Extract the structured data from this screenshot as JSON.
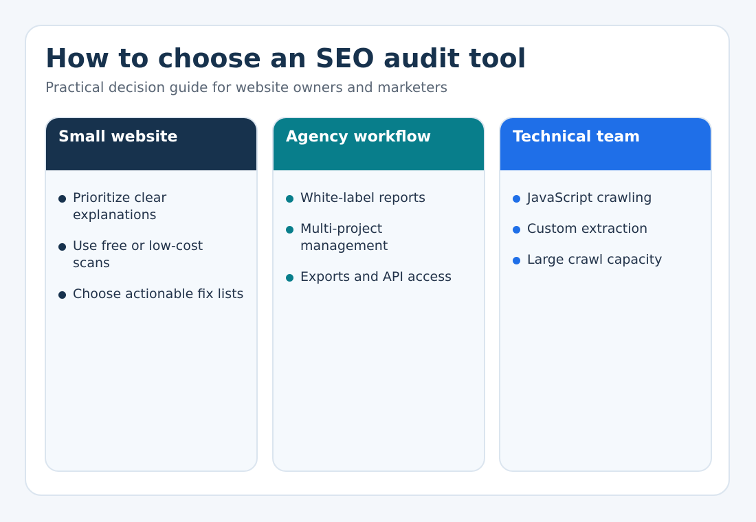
{
  "header": {
    "title": "How to choose an SEO audit tool",
    "subtitle": "Practical decision guide for website owners and marketers"
  },
  "columns": [
    {
      "title": "Small website",
      "accent": "#17324d",
      "items": [
        "Prioritize clear explanations",
        "Use free or low-cost scans",
        "Choose actionable fix lists"
      ]
    },
    {
      "title": "Agency workflow",
      "accent": "#087e8b",
      "items": [
        "White-label reports",
        "Multi-project management",
        "Exports and API access"
      ]
    },
    {
      "title": "Technical team",
      "accent": "#1f6fe8",
      "items": [
        "JavaScript crawling",
        "Custom extraction",
        "Large crawl capacity"
      ]
    }
  ]
}
